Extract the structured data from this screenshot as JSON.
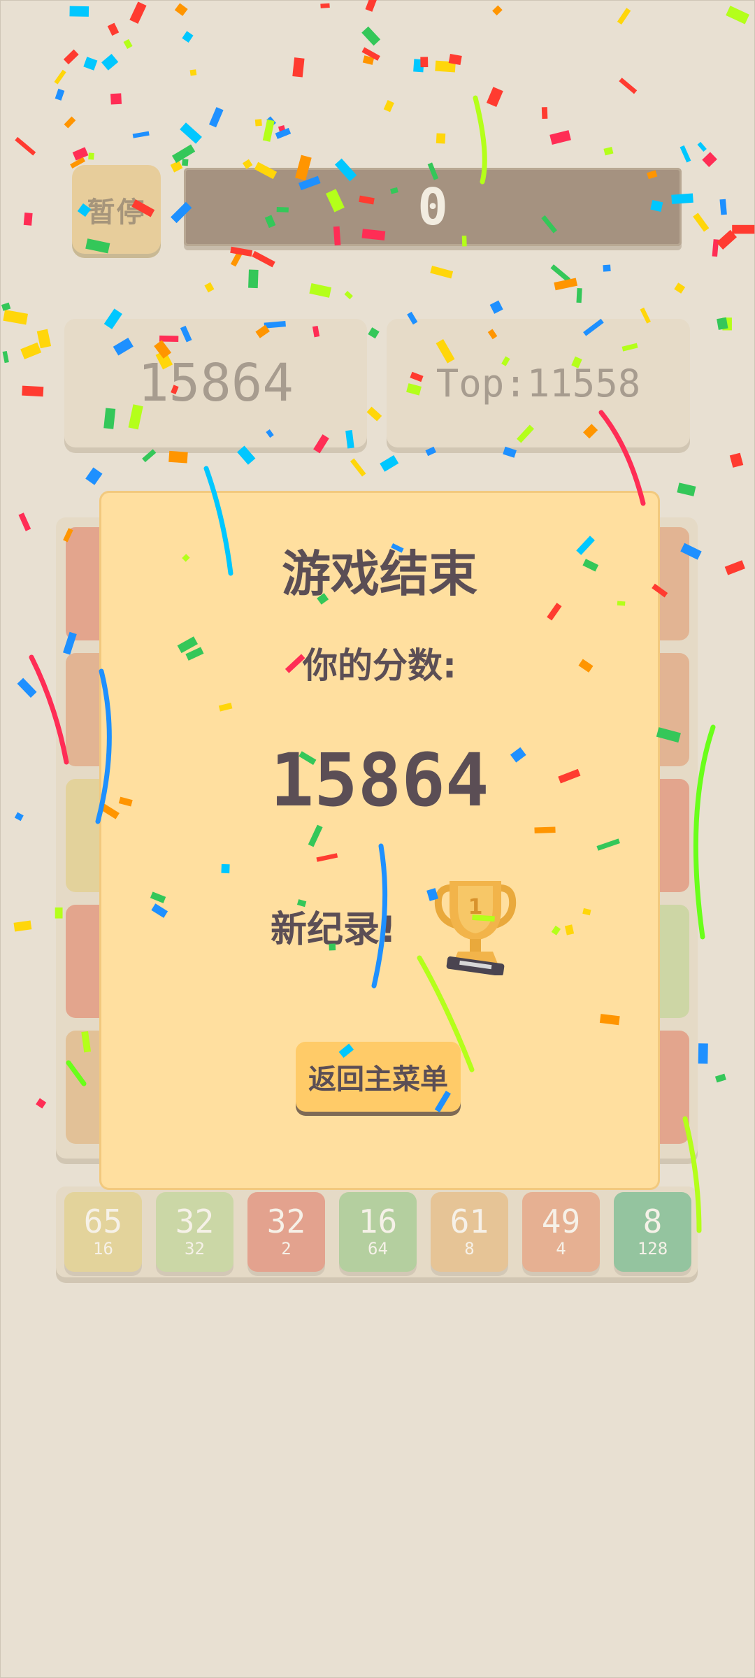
{
  "top_bar": {
    "pause_label": "暂停",
    "counter_value": "0",
    "score_value": "15864",
    "top_label": "Top:11558"
  },
  "board": {
    "tile_colors": [
      "#e3a58d",
      "#e2b493",
      "#e3d29b",
      "#e3a58d",
      "#e2c197"
    ],
    "right_tile_colors": [
      "#e2b493",
      "#e2b493",
      "#e3a58d",
      "#cdd6a5",
      "#e3a58d"
    ]
  },
  "tile_row": [
    {
      "big": "65",
      "small": "16",
      "color": "#e3d39b"
    },
    {
      "big": "32",
      "small": "32",
      "color": "#cbd7a6"
    },
    {
      "big": "32",
      "small": "2",
      "color": "#e3a28e"
    },
    {
      "big": "16",
      "small": "64",
      "color": "#b4cf9f"
    },
    {
      "big": "61",
      "small": "8",
      "color": "#e6c496"
    },
    {
      "big": "49",
      "small": "4",
      "color": "#e6b092"
    },
    {
      "big": "8",
      "small": "128",
      "color": "#94c49f"
    }
  ],
  "modal": {
    "title": "游戏结束",
    "subtitle": "你的分数:",
    "score": "15864",
    "record_text": "新纪录!",
    "trophy_number": "1",
    "menu_button_label": "返回主菜单"
  },
  "colors": {
    "background": "#e8e0d2",
    "modal": "#ffdf9f",
    "button": "#ffcb68",
    "text": "#5b4e55"
  }
}
